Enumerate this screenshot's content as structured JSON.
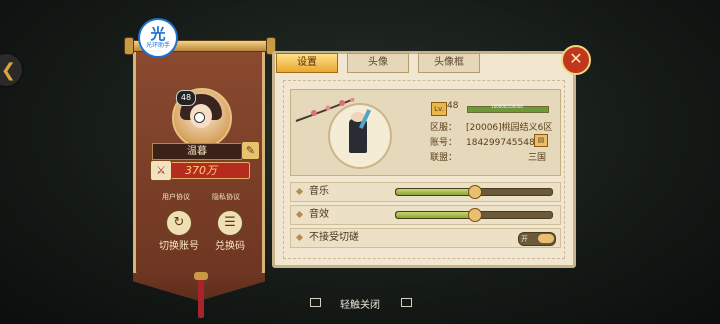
{
  "logo": {
    "big": "光",
    "small": "光环助手"
  },
  "player": {
    "level": "48",
    "name": "温暮",
    "power": "370万"
  },
  "links": {
    "user_agreement": "用户协议",
    "privacy": "隐私协议"
  },
  "actions": {
    "switch_account": "切换账号",
    "redeem_code": "兑换码"
  },
  "tabs": [
    {
      "label": "设置",
      "active": true
    },
    {
      "label": "头像",
      "active": false
    },
    {
      "label": "头像框",
      "active": false
    }
  ],
  "profile": {
    "lv_label": "Lv.",
    "level": "48",
    "exp_label": "100000/100000",
    "exp_fraction": 1.0,
    "rows": [
      {
        "label": "区服：",
        "value": "[20006]桃园结义6区"
      },
      {
        "label": "账号：",
        "value": "184299745548"
      },
      {
        "label": "联盟：",
        "value": "三国"
      }
    ]
  },
  "settings": [
    {
      "label": "音乐",
      "type": "slider",
      "value": 0.5
    },
    {
      "label": "音效",
      "type": "slider",
      "value": 0.5
    },
    {
      "label": "不接受切磋",
      "type": "toggle",
      "state": "开"
    }
  ],
  "footer": {
    "tap_close": "轻触关闭"
  },
  "colors": {
    "accent": "#e9a830",
    "banner": "#7a3e26",
    "panel": "#f1e7d0",
    "close": "#c0361e"
  }
}
